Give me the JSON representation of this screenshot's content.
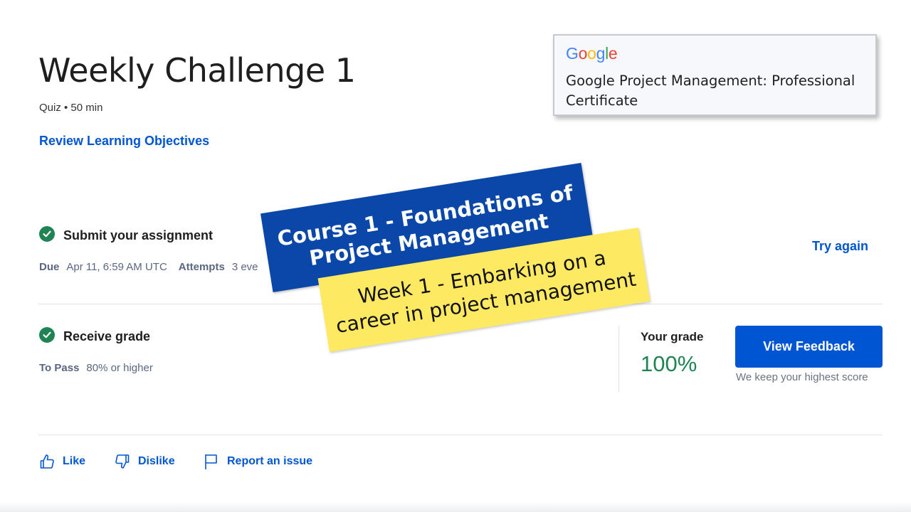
{
  "header": {
    "title": "Weekly Challenge 1",
    "meta": "Quiz • 50 min",
    "review_link": "Review Learning Objectives"
  },
  "submit_step": {
    "title": "Submit your assignment",
    "due_label": "Due",
    "due_value": "Apr 11, 6:59 AM UTC",
    "attempts_label": "Attempts",
    "attempts_value": "3 eve",
    "action": "Try again"
  },
  "grade_step": {
    "title": "Receive grade",
    "pass_label": "To Pass",
    "pass_value": "80% or higher",
    "your_grade_label": "Your grade",
    "your_grade_value": "100%",
    "feedback_button": "View Feedback",
    "note": "We keep your highest score"
  },
  "footer_actions": {
    "like": "Like",
    "dislike": "Dislike",
    "report": "Report an issue"
  },
  "cert_card": {
    "logo": "Google",
    "title": "Google Project Management: Professional Certificate"
  },
  "overlay": {
    "course_line1": "Course 1 - Foundations of",
    "course_line2": "Project Management",
    "week_line1": "Week 1 - Embarking on a",
    "week_line2": "career in project management"
  },
  "colors": {
    "accent": "#0056d2",
    "success": "#1f8354",
    "banner_blue": "#0a47a8",
    "banner_yellow": "#fde962"
  },
  "icons": [
    "check-circle-icon",
    "thumbs-up-icon",
    "thumbs-down-icon",
    "flag-icon"
  ]
}
